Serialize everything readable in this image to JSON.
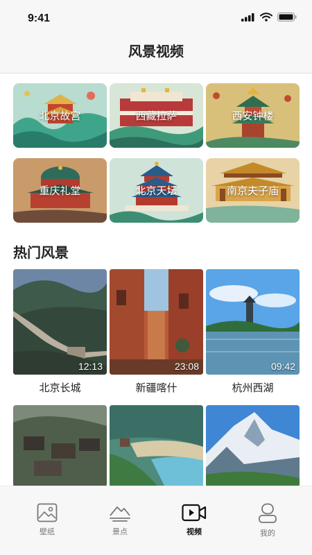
{
  "status_bar": {
    "time": "9:41"
  },
  "header": {
    "title": "风景视频"
  },
  "categories": [
    {
      "label": "北京故宫",
      "icon": "palace-illustration"
    },
    {
      "label": "西藏拉萨",
      "icon": "potala-illustration"
    },
    {
      "label": "西安钟楼",
      "icon": "bell-tower-illustration"
    },
    {
      "label": "重庆礼堂",
      "icon": "hall-illustration"
    },
    {
      "label": "北京天坛",
      "icon": "temple-of-heaven-illustration"
    },
    {
      "label": "南京夫子庙",
      "icon": "confucius-temple-illustration"
    }
  ],
  "hot": {
    "title": "热门风景",
    "videos": [
      {
        "title": "北京长城",
        "duration": "12:13"
      },
      {
        "title": "新疆喀什",
        "duration": "23:08"
      },
      {
        "title": "杭州西湖",
        "duration": "09:42"
      }
    ]
  },
  "tabs": [
    {
      "label": "壁纸",
      "icon": "picture-icon"
    },
    {
      "label": "景点",
      "icon": "mountain-icon"
    },
    {
      "label": "视频",
      "icon": "video-camera-icon"
    },
    {
      "label": "我的",
      "icon": "user-icon"
    }
  ],
  "colors": {
    "accent": "#111111",
    "inactive": "#777777",
    "header_bg": "#f7f7f7"
  }
}
